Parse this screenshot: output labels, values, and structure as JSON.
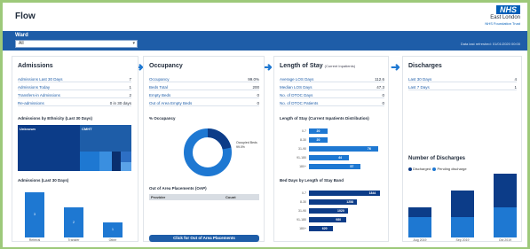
{
  "header": {
    "title": "Flow",
    "nhs_logo": "NHS",
    "trust_name": "East London",
    "trust_sub": "NHS Foundation Trust"
  },
  "filter": {
    "ward_label": "Ward",
    "ward_value": "All",
    "updated_text": "Data last refreshed: 01/01/2020 00:00"
  },
  "panels": {
    "admissions": {
      "title": "Admissions",
      "rows": [
        {
          "k": "Admissions Last 30 Days",
          "v": "7"
        },
        {
          "k": "Admissions Today",
          "v": "1"
        },
        {
          "k": "Transfers-in Admissions",
          "v": "2"
        },
        {
          "k": "Re-admissions",
          "v": "0 in 30 days"
        }
      ],
      "treemap_title": "Admissions by Ethnicity (Last 30 Days)",
      "treemap": [
        {
          "label": "Unknown",
          "color": "#0c3c88"
        },
        {
          "label": "CMHT",
          "color": "#1e5da8"
        },
        {
          "label": "",
          "color": "#1e78d2"
        },
        {
          "label": "",
          "color": "#3a8fe0"
        },
        {
          "label": "",
          "color": "#0a2f6e"
        },
        {
          "label": "",
          "color": "#2d6fc4"
        },
        {
          "label": "",
          "color": "#5aa2e8"
        }
      ],
      "chart_title": "Admissions (Last 30 Days)",
      "bars": [
        {
          "label": "Referral",
          "value": 3
        },
        {
          "label": "Transfer",
          "value": 2
        },
        {
          "label": "Other",
          "value": 1
        }
      ],
      "bar_values": [
        "3",
        "2",
        "1"
      ]
    },
    "occupancy": {
      "title": "Occupancy",
      "rows": [
        {
          "k": "Occupancy",
          "v": "99.0%"
        },
        {
          "k": "Beds Total",
          "v": "200"
        },
        {
          "k": "Empty Beds",
          "v": "0"
        },
        {
          "k": "Out of Area Empty Beds",
          "v": "0"
        }
      ],
      "chart_title": "% Occupancy",
      "donut_label": "Occupied Beds 99.0%",
      "table_title": "Out of Area Placements (OAP)",
      "table_headers": [
        "Provider",
        "Count"
      ],
      "button": "Click for Out of Area Placements"
    },
    "los": {
      "title": "Length of Stay",
      "title_sub": "(Current Inpatients)",
      "rows": [
        {
          "k": "Average LOS Days",
          "v": "112.6"
        },
        {
          "k": "Median LOS Days",
          "v": "47.3"
        },
        {
          "k": "No. of DTOC Days",
          "v": "0"
        },
        {
          "k": "No. of DTOC Patients",
          "v": "0"
        }
      ],
      "chart1_title": "Length of Stay (Current Inpatients Distribution)",
      "chart1_rows": [
        {
          "label": "0-7",
          "value": 20
        },
        {
          "label": "8-30",
          "value": 20
        },
        {
          "label": "31-90",
          "value": 76
        },
        {
          "label": "91-180",
          "value": 44
        },
        {
          "label": "180+",
          "value": 57
        }
      ],
      "chart2_title": "Bed Days by Length of Stay Band",
      "chart2_rows": [
        {
          "label": "0-7",
          "value": 1844
        },
        {
          "label": "8-30",
          "value": 1258
        },
        {
          "label": "31-90",
          "value": 1020
        },
        {
          "label": "91-180",
          "value": 980
        },
        {
          "label": "180+",
          "value": 620
        }
      ]
    },
    "discharges": {
      "title": "Discharges",
      "rows": [
        {
          "k": "Last 30 Days",
          "v": "4"
        },
        {
          "k": "Last 7 Days",
          "v": "1"
        }
      ],
      "chart_title": "Number of Discharges",
      "legend": [
        {
          "label": "Discharged",
          "color": "#0c3c88"
        },
        {
          "label": "Pending discharge",
          "color": "#1e78d2"
        }
      ],
      "bars": [
        {
          "label": "Aug 2019",
          "dark": 3,
          "light": 6
        },
        {
          "label": "Sep 2019",
          "dark": 8,
          "light": 6
        },
        {
          "label": "Oct 2019",
          "dark": 10,
          "light": 9
        }
      ]
    }
  }
}
